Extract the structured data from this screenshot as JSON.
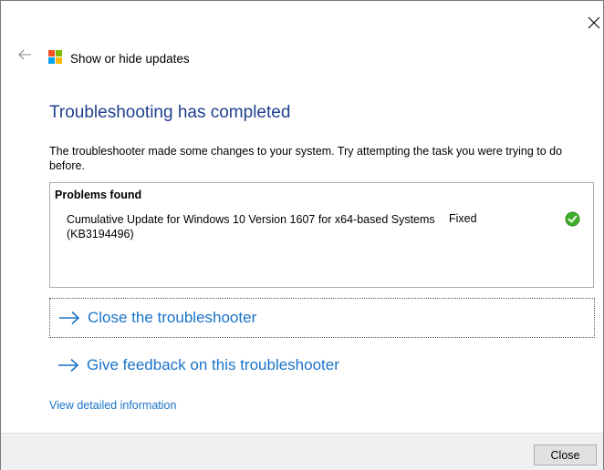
{
  "app": {
    "title": "Show or hide updates"
  },
  "main": {
    "heading": "Troubleshooting has completed",
    "description": "The troubleshooter made some changes to your system. Try attempting the task you were trying to do before.",
    "problems": {
      "header": "Problems found",
      "items": [
        {
          "name": "Cumulative Update for Windows 10 Version 1607 for x64-based Systems (KB3194496)",
          "status": "Fixed"
        }
      ]
    },
    "commands": [
      {
        "label": "Close the troubleshooter"
      },
      {
        "label": "Give feedback on this troubleshooter"
      }
    ],
    "details_link": "View detailed information"
  },
  "footer": {
    "close_label": "Close"
  },
  "colors": {
    "accent": "#1a73c8",
    "heading": "#1f3f8f",
    "status_ok": "#3fae2a"
  },
  "icons": [
    "close-icon",
    "back-arrow-icon",
    "app-logo-icon",
    "checkmark-icon",
    "right-arrow-icon"
  ]
}
